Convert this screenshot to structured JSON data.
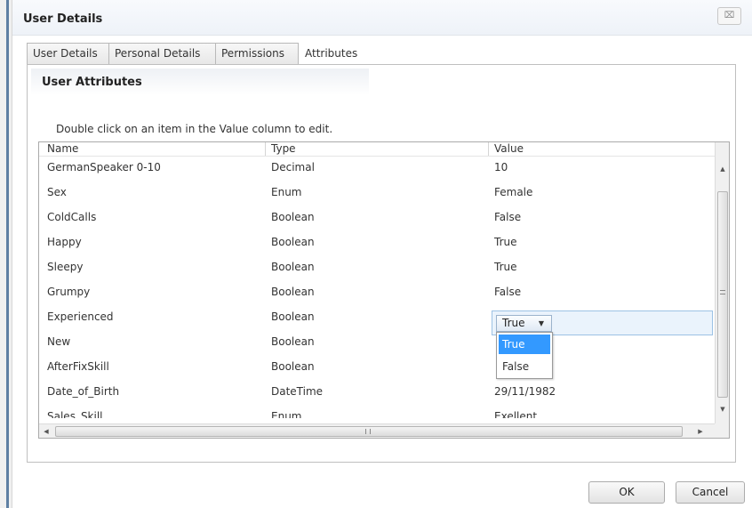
{
  "dialog": {
    "title": "User Details",
    "close_label": "⌧"
  },
  "tabs": [
    {
      "label": "User Details"
    },
    {
      "label": "Personal Details"
    },
    {
      "label": "Permissions"
    },
    {
      "label": "Attributes",
      "active": true
    }
  ],
  "panel": {
    "title": "User Attributes",
    "instruction": "Double click on an item in the Value column to edit."
  },
  "grid": {
    "columns": [
      "Name",
      "Type",
      "Value"
    ],
    "rows": [
      {
        "name": "GermanSpeaker 0-10",
        "type": "Decimal",
        "value": "10"
      },
      {
        "name": "Sex",
        "type": "Enum",
        "value": "Female"
      },
      {
        "name": "ColdCalls",
        "type": "Boolean",
        "value": "False"
      },
      {
        "name": "Happy",
        "type": "Boolean",
        "value": "True"
      },
      {
        "name": "Sleepy",
        "type": "Boolean",
        "value": "True"
      },
      {
        "name": "Grumpy",
        "type": "Boolean",
        "value": "False"
      },
      {
        "name": "Experienced",
        "type": "Boolean",
        "value": "True"
      },
      {
        "name": "New",
        "type": "Boolean",
        "value": ""
      },
      {
        "name": "AfterFixSkill",
        "type": "Boolean",
        "value": ""
      },
      {
        "name": "Date_of_Birth",
        "type": "DateTime",
        "value": "29/11/1982"
      },
      {
        "name": "Sales_Skill",
        "type": "Enum",
        "value": "Exellent"
      }
    ],
    "editor": {
      "selected": "True",
      "caret": "▼",
      "options": [
        "True",
        "False"
      ]
    },
    "scroll": {
      "up": "▲",
      "down": "▼",
      "left": "◀",
      "right": "▶"
    }
  },
  "buttons": {
    "ok": "OK",
    "cancel": "Cancel"
  },
  "colors": {
    "selection": "#3399ff",
    "editor_bg": "#eaf3fc"
  }
}
